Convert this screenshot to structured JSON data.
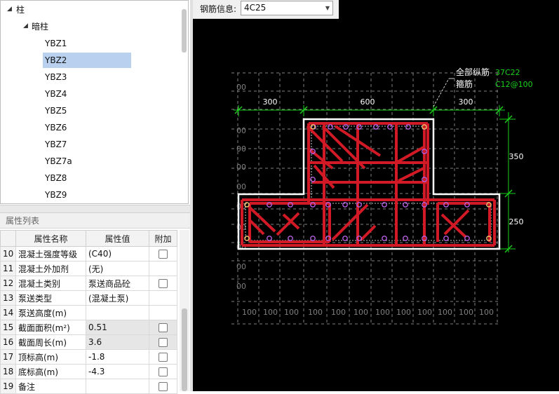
{
  "tree": {
    "root_label": "柱",
    "group_label": "暗柱",
    "items": [
      "YBZ1",
      "YBZ2",
      "YBZ3",
      "YBZ4",
      "YBZ5",
      "YBZ6",
      "YBZ7",
      "YBZ7a",
      "YBZ8",
      "YBZ9"
    ],
    "selected": "YBZ2"
  },
  "props": {
    "panel_title": "属性列表",
    "headers": {
      "name": "属性名称",
      "value": "属性值",
      "extra": "附加"
    },
    "rows": [
      {
        "no": "10",
        "name": "混凝土强度等级",
        "value": "(C40)",
        "blue": true,
        "grey": false,
        "checkbox": true
      },
      {
        "no": "11",
        "name": "混凝土外加剂",
        "value": "(无)",
        "blue": true,
        "grey": false,
        "checkbox": false
      },
      {
        "no": "12",
        "name": "混凝土类别",
        "value": "泵送商品砼",
        "blue": true,
        "grey": false,
        "checkbox": true
      },
      {
        "no": "13",
        "name": "泵送类型",
        "value": "(混凝土泵)",
        "blue": true,
        "grey": false,
        "checkbox": false
      },
      {
        "no": "14",
        "name": "泵送高度(m)",
        "value": "",
        "blue": false,
        "grey": false,
        "checkbox": false
      },
      {
        "no": "15",
        "name": "截面面积(m²)",
        "value": "0.51",
        "blue": true,
        "grey": true,
        "checkbox": true
      },
      {
        "no": "16",
        "name": "截面周长(m)",
        "value": "3.6",
        "blue": true,
        "grey": true,
        "checkbox": true
      },
      {
        "no": "17",
        "name": "顶标高(m)",
        "value": "-1.8",
        "blue": false,
        "grey": false,
        "checkbox": true
      },
      {
        "no": "18",
        "name": "底标高(m)",
        "value": "-4.3",
        "blue": false,
        "grey": false,
        "checkbox": true
      },
      {
        "no": "19",
        "name": "备注",
        "value": "",
        "blue": false,
        "grey": false,
        "checkbox": true
      }
    ]
  },
  "toolbar": {
    "rebar_label": "钢筋信息:",
    "rebar_value": "4C25"
  },
  "drawing": {
    "label_longitudinal": "全部纵筋",
    "value_longitudinal": "37C22",
    "label_stirrup": "箍筋",
    "value_stirrup": "C12@100",
    "dim_top": [
      "300",
      "600",
      "300"
    ],
    "dim_right": [
      "350",
      "250"
    ],
    "grid_bottom": "100",
    "grid_left": "00",
    "colors": {
      "concrete": "#ffffff",
      "rebar": "#d11a25",
      "dimension": "#19d119",
      "point": "#b65fe0",
      "grid": "#7f7f7f"
    }
  }
}
